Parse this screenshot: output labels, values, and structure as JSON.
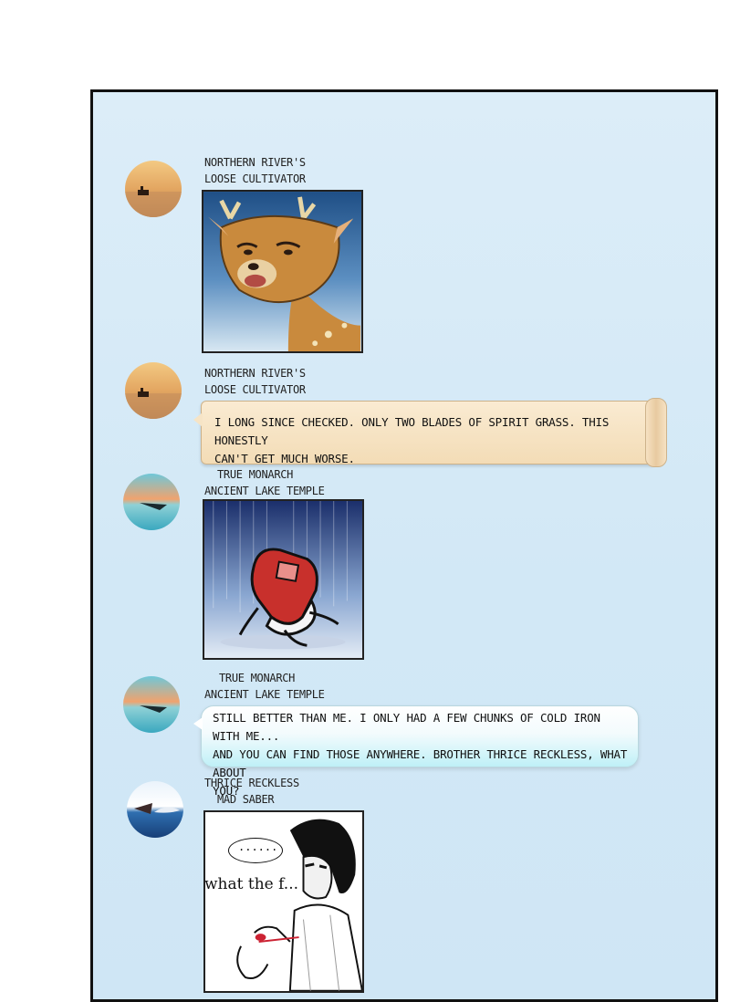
{
  "messages": [
    {
      "sender_line1": "Northern River's",
      "sender_line2": "Loose Cultivator",
      "type": "sticker",
      "sticker": "deer-meme-icon"
    },
    {
      "sender_line1": "Northern River's",
      "sender_line2": "Loose Cultivator",
      "type": "text",
      "text_line1": "I long since checked. Only two blades of spirit grass. This honestly",
      "text_line2": "can't get much worse."
    },
    {
      "sender_line1": "True Monarch",
      "sender_line2": "Ancient Lake Temple",
      "type": "sticker",
      "sticker": "collapsed-pill-icon"
    },
    {
      "sender_line1": "True Monarch",
      "sender_line2": "Ancient Lake Temple",
      "type": "text",
      "text_line1": "Still better than me. I only had a few chunks of cold iron with me...",
      "text_line2": "And you can find those anywhere. Brother Thrice Reckless, what about",
      "text_line3": "you?"
    },
    {
      "sender_line1": "Thrice Reckless",
      "sender_line2": "Mad Saber",
      "type": "sticker",
      "sticker": "confused-man-icon",
      "sticker_bubble": "......",
      "sticker_caption": "what the f..."
    }
  ],
  "colors": {
    "panel_bg": "#d6ebf7",
    "scroll_bubble": "#f6e2c3",
    "cyan_bubble": "#bff0f7"
  }
}
